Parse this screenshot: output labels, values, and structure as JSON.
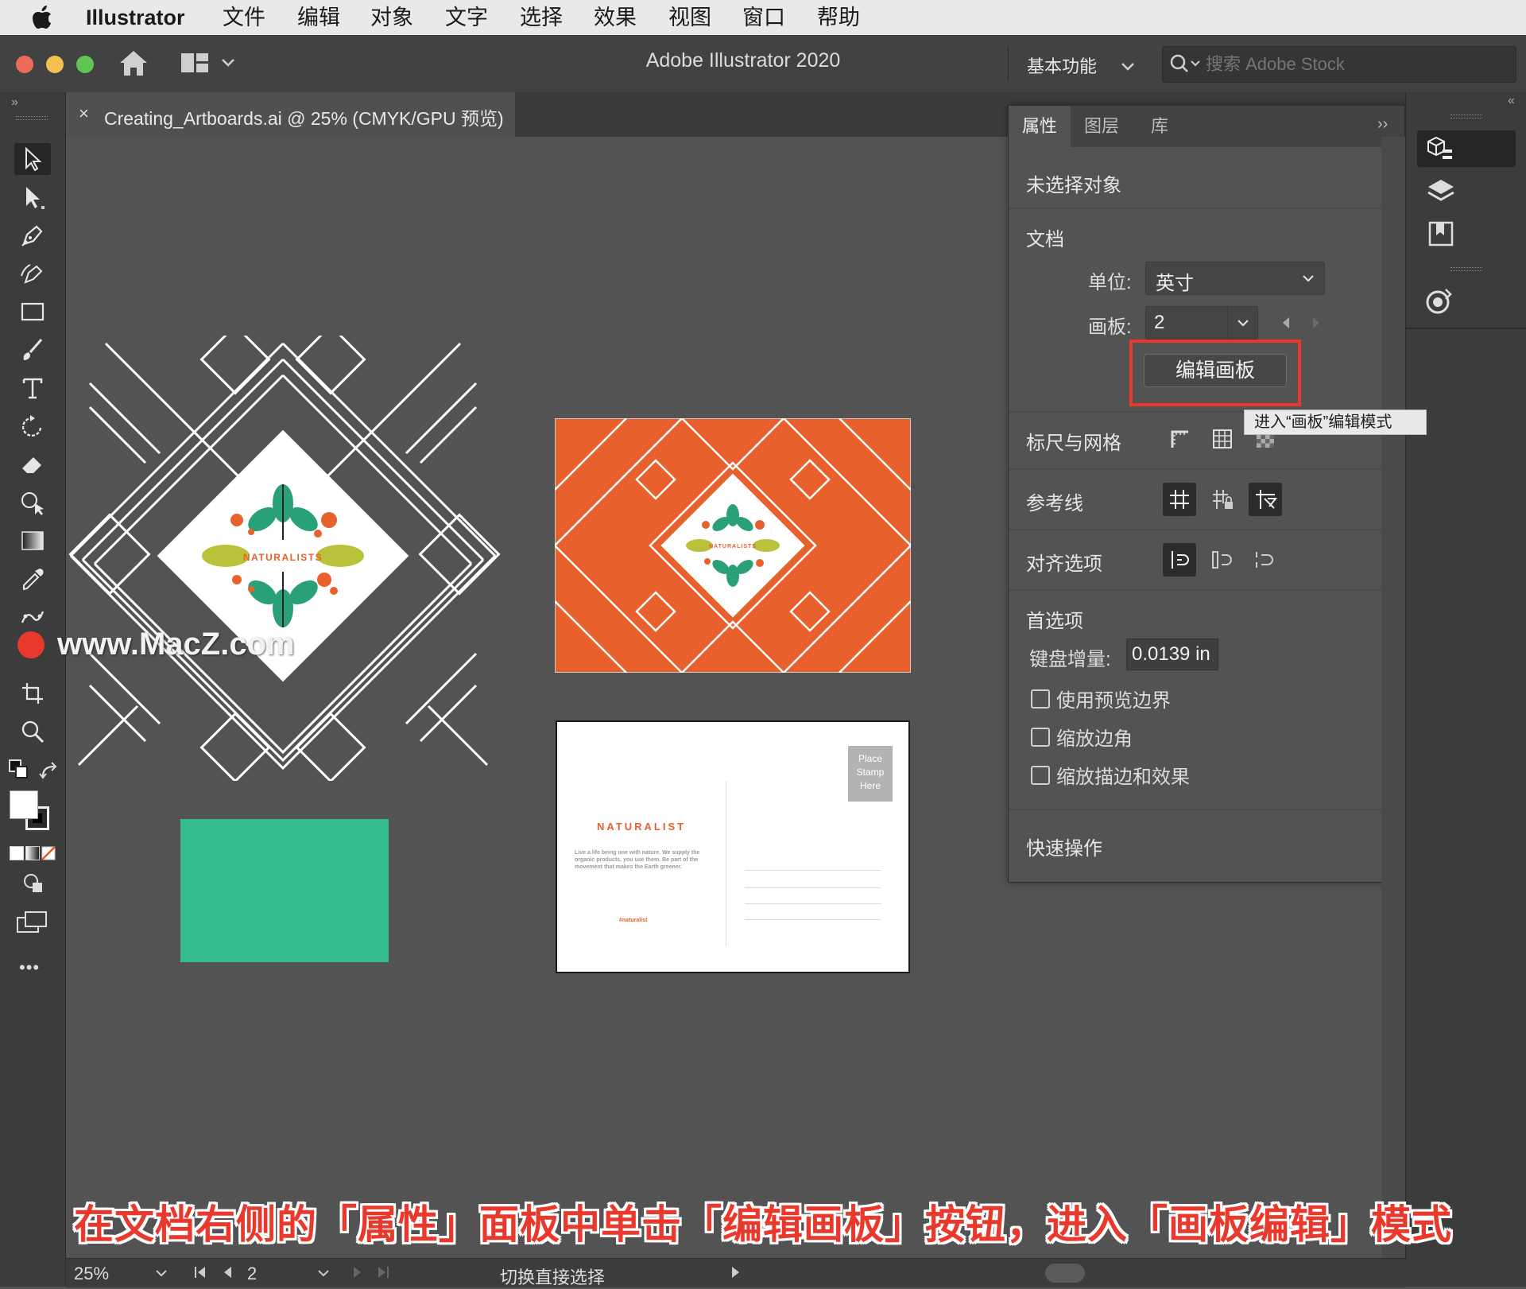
{
  "menubar": {
    "app_name": "Illustrator",
    "items": [
      "文件",
      "编辑",
      "对象",
      "文字",
      "选择",
      "效果",
      "视图",
      "窗口",
      "帮助"
    ]
  },
  "titlebar": {
    "window_title": "Adobe Illustrator 2020",
    "workspace_label": "基本功能",
    "search_placeholder": "搜索 Adobe Stock"
  },
  "document_tab": {
    "close_label": "×",
    "title": "Creating_Artboards.ai @ 25% (CMYK/GPU 预览)"
  },
  "toolbar": {
    "more_label": "•••",
    "tools": [
      "selection-tool",
      "direct-selection-tool",
      "pen-tool",
      "curvature-tool",
      "rectangle-tool",
      "paintbrush-tool",
      "type-tool",
      "rotate-tool",
      "eraser-tool",
      "shape-builder-tool",
      "gradient-tool",
      "eyedropper-tool",
      "puppet-warp-tool",
      "artboard-tool",
      "zoom-tool"
    ]
  },
  "properties_panel": {
    "tabs": [
      "属性",
      "图层",
      "库"
    ],
    "no_selection": "未选择对象",
    "document_section": "文档",
    "units_label": "单位:",
    "units_value": "英寸",
    "artboard_label": "画板:",
    "artboard_value": "2",
    "edit_artboards_button": "编辑画板",
    "tooltip": "进入“画板”编辑模式",
    "rulers_grids_label": "标尺与网格",
    "guides_label": "参考线",
    "align_label": "对齐选项",
    "preferences_label": "首选项",
    "keyboard_increment_label": "键盘增量:",
    "keyboard_increment_value": "0.0139 in",
    "checkboxes": [
      {
        "label": "使用预览边界",
        "checked": false
      },
      {
        "label": "缩放边角",
        "checked": false
      },
      {
        "label": "缩放描边和效果",
        "checked": false
      }
    ],
    "quick_actions_label": "快速操作",
    "highlight_color": "#e8392c"
  },
  "canvas": {
    "brand_text": "NATURALISTS",
    "postcard": {
      "title": "NATURALIST",
      "body": "Live a life being one with nature. We supply the organic products, you use them. Be part of the movement that makes the Earth greener.",
      "hashtag": "#naturalist",
      "stamp": [
        "Place",
        "Stamp",
        "Here"
      ]
    },
    "orange_color": "#e8612c",
    "green_color": "#35bb90",
    "leaf_color": "#2aa07a",
    "lime_color": "#b9c23a"
  },
  "statusbar": {
    "zoom": "25%",
    "artboard": "2",
    "tool_hint": "切换直接选择"
  },
  "watermark": "www.MacZ.com",
  "caption": "在文档右侧的「属性」面板中单击「编辑画板」按钮，进入「画板编辑」模式"
}
